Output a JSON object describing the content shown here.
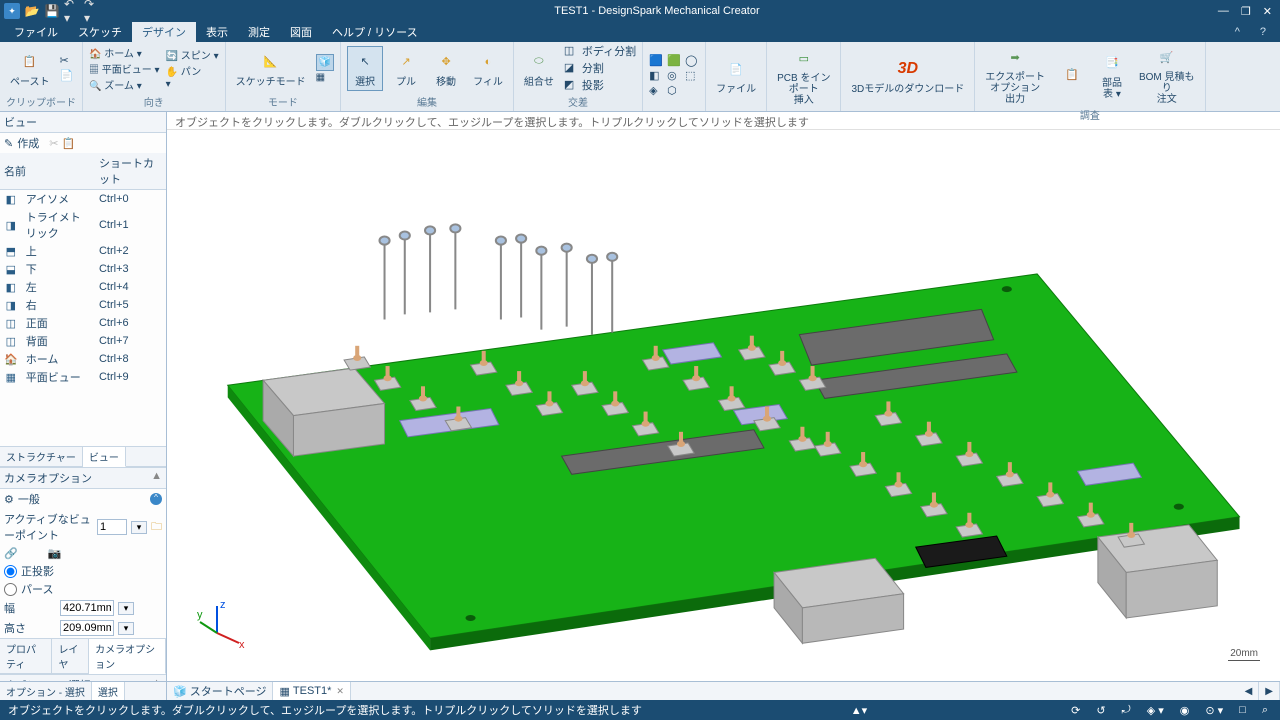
{
  "app_title": "TEST1 - DesignSpark Mechanical Creator",
  "qat": [
    "logo",
    "open",
    "save",
    "undo",
    "redo"
  ],
  "window_buttons": [
    "minimize",
    "maximize",
    "close"
  ],
  "menu_tabs": [
    "ファイル",
    "スケッチ",
    "デザイン",
    "表示",
    "測定",
    "図面",
    "ヘルプ / リソース"
  ],
  "menu_active": 2,
  "ribbon": {
    "groups": [
      {
        "title": "クリップボード",
        "buttons": [
          {
            "label": "ペースト",
            "icon": "📋"
          }
        ],
        "small": [
          {
            "label": "",
            "icon": "✂"
          },
          {
            "label": "",
            "icon": "📄"
          }
        ]
      },
      {
        "title": "向き",
        "lists": [
          [
            "🏠 ホーム ▾",
            "▦ 平面ビュー ▾",
            "🔍 ズーム ▾"
          ],
          [
            "🔄 スピン ▾",
            "✋ パン",
            "  ▾"
          ]
        ]
      },
      {
        "title": "モード",
        "buttons": [
          {
            "label": "スケッチモード",
            "icon": "✏️"
          },
          {
            "label": "",
            "icon": "🧊"
          },
          {
            "label": "",
            "icon": "▦"
          }
        ]
      },
      {
        "title": "編集",
        "buttons": [
          {
            "label": "選択",
            "icon": "↖",
            "active": true
          },
          {
            "label": "プル",
            "icon": "↗"
          },
          {
            "label": "移動",
            "icon": "✥"
          },
          {
            "label": "フィル",
            "icon": "◐"
          }
        ]
      },
      {
        "title": "交差",
        "buttons": [
          {
            "label": "組合せ",
            "icon": "⬭"
          }
        ],
        "lists": [
          [
            "ボディ分割",
            "分割",
            "投影"
          ]
        ]
      },
      {
        "title": "",
        "buttons3x2": true
      },
      {
        "title": "",
        "buttons": [
          {
            "label": "ファイル",
            "icon": "📄"
          }
        ]
      },
      {
        "title": "",
        "buttons": [
          {
            "label": "PCB をイン\nポート\n挿入",
            "icon": "📗"
          }
        ]
      },
      {
        "title": "",
        "buttons": [
          {
            "label": "3Dモデルのダウンロード",
            "icon": "3D",
            "color": "#d83b01"
          }
        ]
      },
      {
        "title": "調査",
        "buttons": [
          {
            "label": "エクスポート\nオプション\n出力",
            "icon": "➡"
          },
          {
            "label": "",
            "icon": "📋"
          },
          {
            "label": "部品\n表 ▾",
            "icon": "📑"
          },
          {
            "label": "BOM 見積も\nり\n注文",
            "icon": "🛒"
          }
        ]
      }
    ]
  },
  "left": {
    "panel_title": "ビュー",
    "create_row": "作成",
    "col_name": "名前",
    "col_shortcut": "ショートカット",
    "views": [
      {
        "icon": "◧",
        "name": "アイソメ",
        "sc": "Ctrl+0"
      },
      {
        "icon": "◨",
        "name": "トライメトリック",
        "sc": "Ctrl+1"
      },
      {
        "icon": "⬒",
        "name": "上",
        "sc": "Ctrl+2"
      },
      {
        "icon": "⬓",
        "name": "下",
        "sc": "Ctrl+3"
      },
      {
        "icon": "◧",
        "name": "左",
        "sc": "Ctrl+4"
      },
      {
        "icon": "◨",
        "name": "右",
        "sc": "Ctrl+5"
      },
      {
        "icon": "◫",
        "name": "正面",
        "sc": "Ctrl+6"
      },
      {
        "icon": "◫",
        "name": "背面",
        "sc": "Ctrl+7"
      },
      {
        "icon": "🏠",
        "name": "ホーム",
        "sc": "Ctrl+8"
      },
      {
        "icon": "▦",
        "name": "平面ビュー",
        "sc": "Ctrl+9"
      }
    ],
    "tabs1": [
      "ストラクチャー",
      "ビュー"
    ],
    "tabs1_active": 1,
    "camera_header": "カメラオプション",
    "general": "一般",
    "vp_label": "アクティブなビューポイント",
    "vp_value": "1",
    "proj_ortho": "正投影",
    "proj_persp": "パース",
    "width_label": "幅",
    "width_value": "420.71mm",
    "height_label": "高さ",
    "height_value": "209.09mm",
    "tabs2": [
      "プロパティ",
      "レイヤ",
      "カメラオプション"
    ],
    "tabs2_active": 2,
    "opts_header": "オプション - 選択"
  },
  "viewport": {
    "hint": "オブジェクトをクリックします。ダブルクリックして、エッジループを選択します。トリプルクリックしてソリッドを選択します",
    "scale": "20mm",
    "axes": {
      "x": "x",
      "y": "y",
      "z": "z"
    }
  },
  "bottom": {
    "left_tabs": [
      "オプション - 選択",
      "選択"
    ],
    "left_active": 1,
    "doc_tabs": [
      {
        "label": "スタートページ",
        "icon": "🧊"
      },
      {
        "label": "TEST1*",
        "icon": "▦",
        "close": true
      }
    ]
  },
  "status": {
    "hint": "オブジェクトをクリックします。ダブルクリックして、エッジループを選択します。トリプルクリックしてソリッドを選択します",
    "right_icons": [
      "▲▾",
      "⟳",
      "↺",
      "↻",
      "⤢",
      "◈",
      "◉",
      "⊙",
      "⋮",
      "□",
      "⌕"
    ]
  }
}
